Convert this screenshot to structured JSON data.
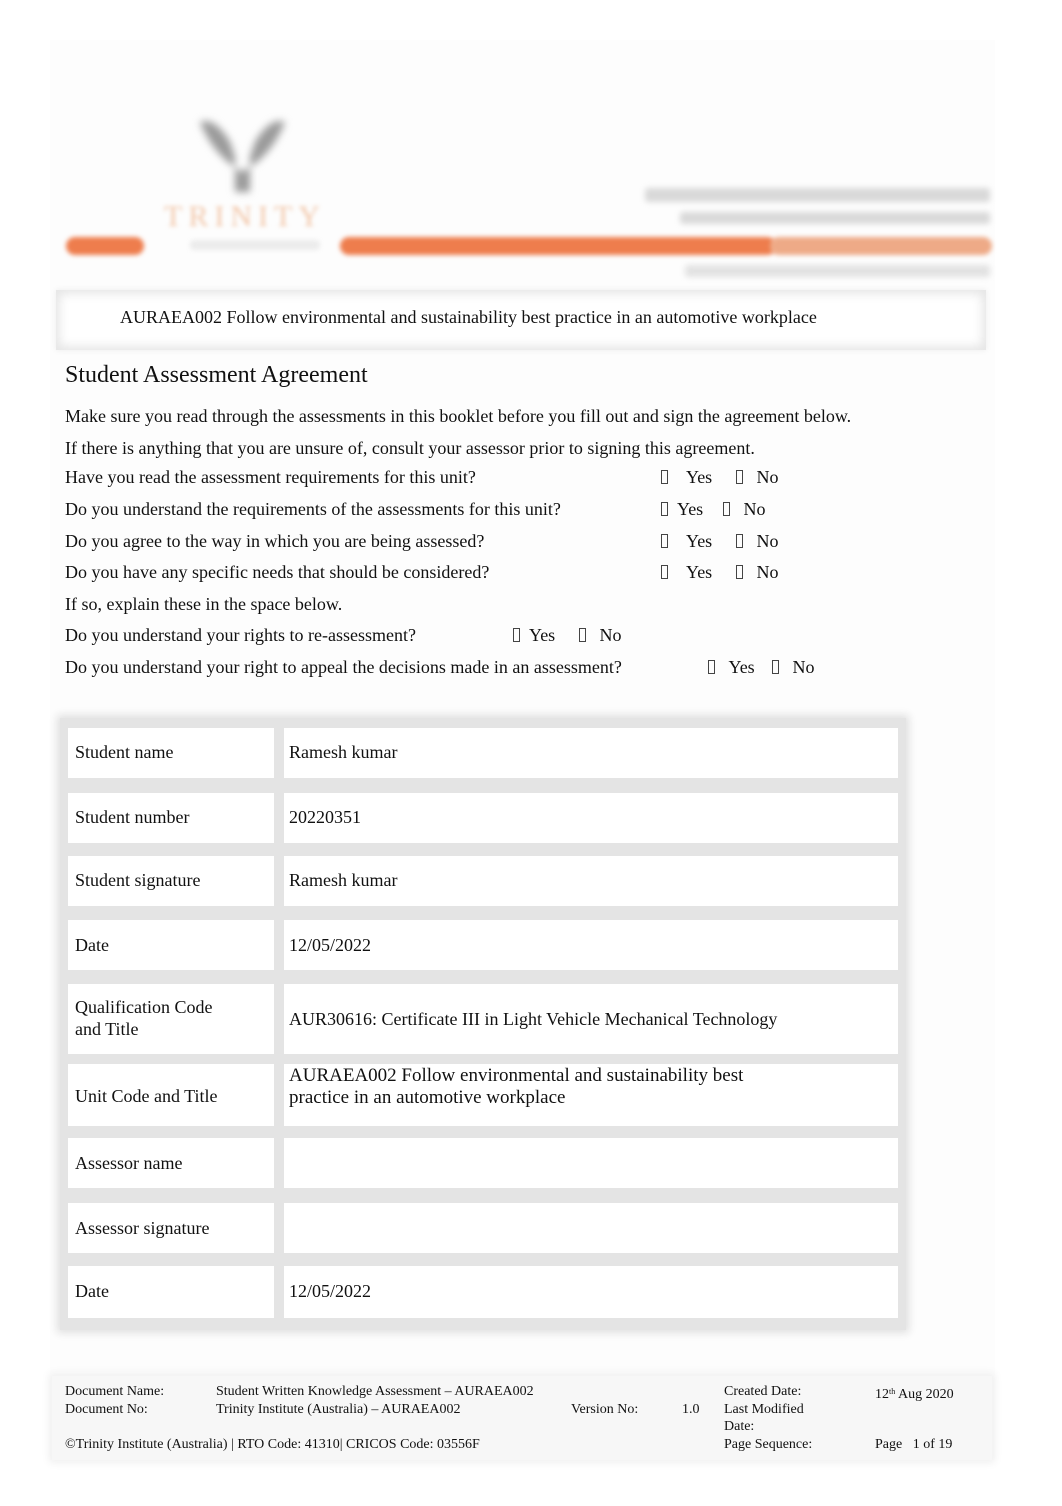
{
  "header": {
    "logo_text": "TRINITY",
    "accent_color": "#ee7d4d",
    "accent_light_color": "#eeaa87"
  },
  "unit_title": "AURAEA002 Follow environmental and sustainability best practice in an automotive workplace",
  "agreement": {
    "title": "Student Assessment Agreement",
    "intro_1": "Make sure you read through the assessments in this booklet before you fill out and sign the agreement below.",
    "intro_2": "If there is anything that you are unsure of, consult your assessor prior to signing this agreement.",
    "questions": [
      {
        "text": "Have you read the assessment requirements for this unit?",
        "yes": "Yes",
        "no": "No"
      },
      {
        "text": "Do you understand the requirements of the assessments for this unit?",
        "yes": "Yes",
        "no": "No"
      },
      {
        "text": "Do you agree to the way in which you are being assessed?",
        "yes": "Yes",
        "no": "No"
      },
      {
        "text": "Do you have any specific needs that should be considered?",
        "yes": "Yes",
        "no": "No"
      },
      {
        "text": "If so, explain these in the space below."
      },
      {
        "text": "Do you understand your rights to re-assessment?",
        "yes": "Yes",
        "no": "No"
      },
      {
        "text": "Do you understand your right to appeal the decisions made in an assessment?",
        "yes": "Yes",
        "no": "No"
      }
    ]
  },
  "student_table": [
    {
      "label": "Student name",
      "value": "Ramesh kumar"
    },
    {
      "label": "Student number",
      "value": "20220351"
    },
    {
      "label": "Student signature",
      "value": "Ramesh kumar"
    },
    {
      "label": "Date",
      "value": "12/05/2022"
    },
    {
      "label": "Qualification Code and Title",
      "label_line1": "Qualification Code",
      "label_line2": "and Title",
      "value": "AUR30616: Certificate III in Light Vehicle Mechanical Technology"
    },
    {
      "label": "Unit Code and Title",
      "value_line1": "AURAEA002 Follow environmental and sustainability best",
      "value_line2": "practice in an automotive workplace"
    },
    {
      "label": "Assessor name",
      "value": ""
    },
    {
      "label": "Assessor signature",
      "value": ""
    },
    {
      "label": "Date",
      "value": "12/05/2022"
    }
  ],
  "footer": {
    "doc_name_label": "Document Name:",
    "doc_name_value": "Student Written Knowledge Assessment – AURAEA002",
    "doc_no_label": "Document No:",
    "doc_no_value": "Trinity Institute (Australia)   – AURAEA002",
    "version_label": "Version No:",
    "version_value": "1.0",
    "created_label": "Created Date:",
    "created_day": "12",
    "created_sup": "th",
    "created_rest": " Aug 2020",
    "modified_label_1": "Last Modified",
    "modified_label_2": "Date:",
    "page_seq_label": "Page Sequence:",
    "page_seq_value": "Page   1 of 19",
    "copyright": "©Trinity Institute (Australia) | RTO Code: 41310| CRICOS Code: 03556F"
  }
}
